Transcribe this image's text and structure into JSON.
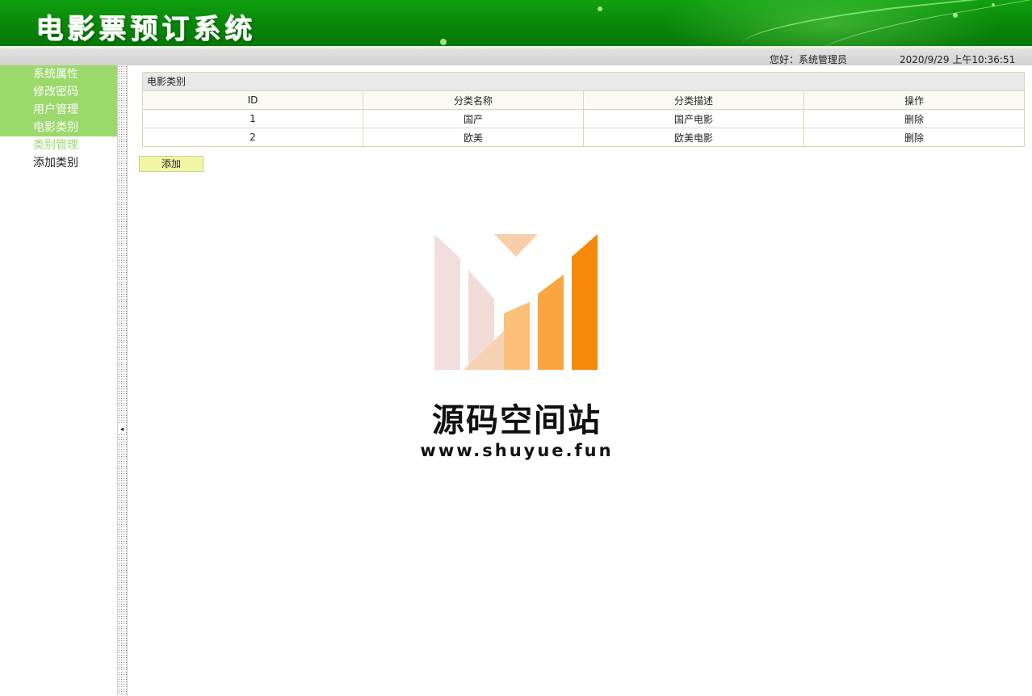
{
  "header": {
    "title": "电影票预订系统",
    "greeting": "您好：系统管理员",
    "datetime": "2020/9/29 上午10:36:51"
  },
  "sidebar": {
    "items": [
      {
        "label": "系统属性"
      },
      {
        "label": "修改密码"
      },
      {
        "label": "用户管理"
      },
      {
        "label": "电影类别"
      }
    ],
    "sub_heading": "类别管理",
    "sub_items": [
      {
        "label": "添加类别"
      }
    ],
    "collapse_glyph": "◂"
  },
  "panel": {
    "title": "电影类别",
    "columns": [
      "ID",
      "分类名称",
      "分类描述",
      "操作"
    ],
    "rows": [
      {
        "id": "1",
        "name": "国产",
        "description": "国产电影",
        "action": "删除"
      },
      {
        "id": "2",
        "name": "欧美",
        "description": "欧美电影",
        "action": "删除"
      }
    ],
    "add_label": "添加"
  },
  "watermark": {
    "title": "源码空间站",
    "url": "www.shuyue.fun"
  },
  "colors": {
    "banner_green": "#0a8a0a",
    "menu_green": "#9bd96b",
    "button_yellow": "#f1f7a5",
    "border": "#d8d8b8",
    "logo_orange": "#f7890a"
  }
}
